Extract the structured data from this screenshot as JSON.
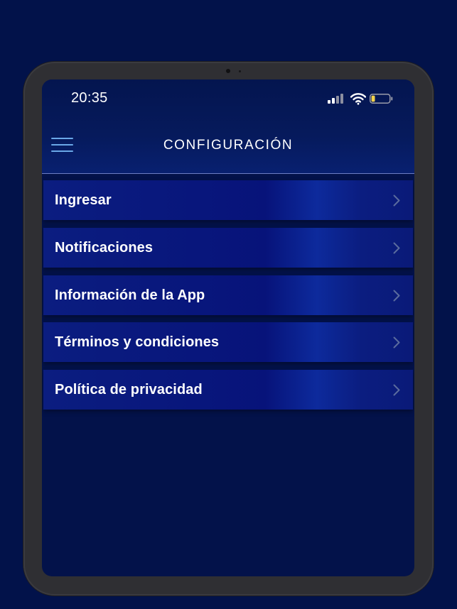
{
  "status_bar": {
    "time": "20:35",
    "signal_icon": "cellular-signal-icon",
    "wifi_icon": "wifi-icon",
    "battery_icon": "battery-icon",
    "battery_level": 0.2,
    "battery_color": "#f2d14b"
  },
  "header": {
    "title": "CONFIGURACIÓN",
    "menu_icon": "hamburger-menu-icon",
    "menu_color": "#6aa8e8"
  },
  "menu": {
    "items": [
      {
        "label": "Ingresar",
        "icon": "chevron-right-icon"
      },
      {
        "label": "Notificaciones",
        "icon": "chevron-right-icon"
      },
      {
        "label": "Información de la App",
        "icon": "chevron-right-icon"
      },
      {
        "label": "Términos y condiciones",
        "icon": "chevron-right-icon"
      },
      {
        "label": "Política de privacidad",
        "icon": "chevron-right-icon"
      }
    ]
  },
  "colors": {
    "background": "#02124a",
    "row": "#0b1d80",
    "text": "#ffffff"
  }
}
